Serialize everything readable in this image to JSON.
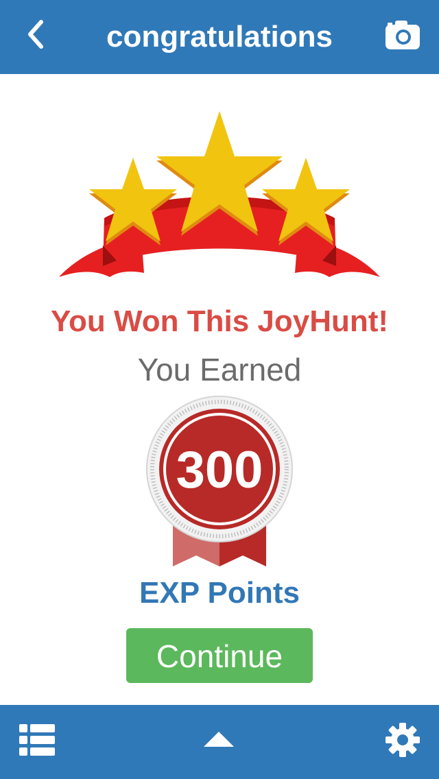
{
  "header": {
    "title": "congratulations",
    "back_icon": "chevron-left-icon",
    "camera_icon": "camera-icon"
  },
  "result": {
    "headline": "You Won This JoyHunt!",
    "earned_text": "You Earned",
    "points": "300",
    "points_label": "EXP Points",
    "continue_label": "Continue"
  },
  "footer": {
    "list_icon": "list-icon",
    "up_icon": "caret-up-icon",
    "settings_icon": "gear-icon"
  },
  "colors": {
    "bar": "#3079b8",
    "headline": "#d94c45",
    "points_label": "#3277b6",
    "continue": "#5cb85c",
    "star": "#f1c40f",
    "ribbon": "#e62020",
    "medal": "#b72a27"
  }
}
